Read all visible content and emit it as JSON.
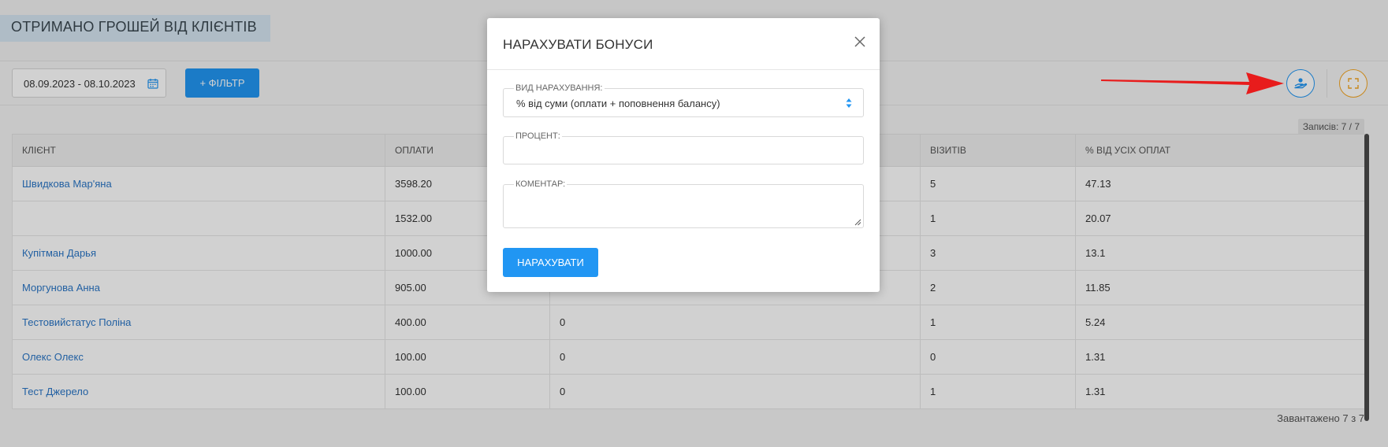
{
  "page": {
    "title": "ОТРИМАНО ГРОШЕЙ ВІД КЛІЄНТІВ"
  },
  "toolbar": {
    "date_range": "08.09.2023 - 08.10.2023",
    "filter_label": "+ ФІЛЬТР",
    "calendar_icon": "calendar-icon",
    "bonus_icon": "hand-coin-icon",
    "fullscreen_icon": "fullscreen-icon"
  },
  "records_label": "Записів: 7 / 7",
  "table": {
    "headers": [
      "КЛІЄНТ",
      "ОПЛАТИ",
      "",
      "ВІЗИТІВ",
      "% ВІД УСІХ ОПЛАТ"
    ],
    "rows": [
      {
        "client": "Швидкова Мар'яна",
        "payments": "3598.20",
        "col3": "",
        "visits": "5",
        "percent": "47.13"
      },
      {
        "client": "",
        "payments": "1532.00",
        "col3": "",
        "visits": "1",
        "percent": "20.07"
      },
      {
        "client": "Купітман Дарья",
        "payments": "1000.00",
        "col3": "",
        "visits": "3",
        "percent": "13.1"
      },
      {
        "client": "Моргунова Анна",
        "payments": "905.00",
        "col3": "",
        "visits": "2",
        "percent": "11.85"
      },
      {
        "client": "Тестовийстатус Поліна",
        "payments": "400.00",
        "col3": "0",
        "visits": "1",
        "percent": "5.24"
      },
      {
        "client": "Олекс Олекс",
        "payments": "100.00",
        "col3": "0",
        "visits": "0",
        "percent": "1.31"
      },
      {
        "client": "Тест Джерело",
        "payments": "100.00",
        "col3": "0",
        "visits": "1",
        "percent": "1.31"
      }
    ]
  },
  "loaded_label": "Завантажено 7 з 7",
  "modal": {
    "title": "НАРАХУВАТИ БОНУСИ",
    "type_label": "ВИД НАРАХУВАННЯ:",
    "type_value": "% від суми (оплати + поповнення балансу)",
    "percent_label": "ПРОЦЕНТ:",
    "percent_value": "",
    "comment_label": "КОМЕНТАР:",
    "comment_value": "",
    "submit_label": "НАРАХУВАТИ"
  },
  "colors": {
    "accent": "#2196f3",
    "link": "#2a76c6",
    "arrow": "#e81c1c",
    "fullscreen": "#f5a623"
  }
}
